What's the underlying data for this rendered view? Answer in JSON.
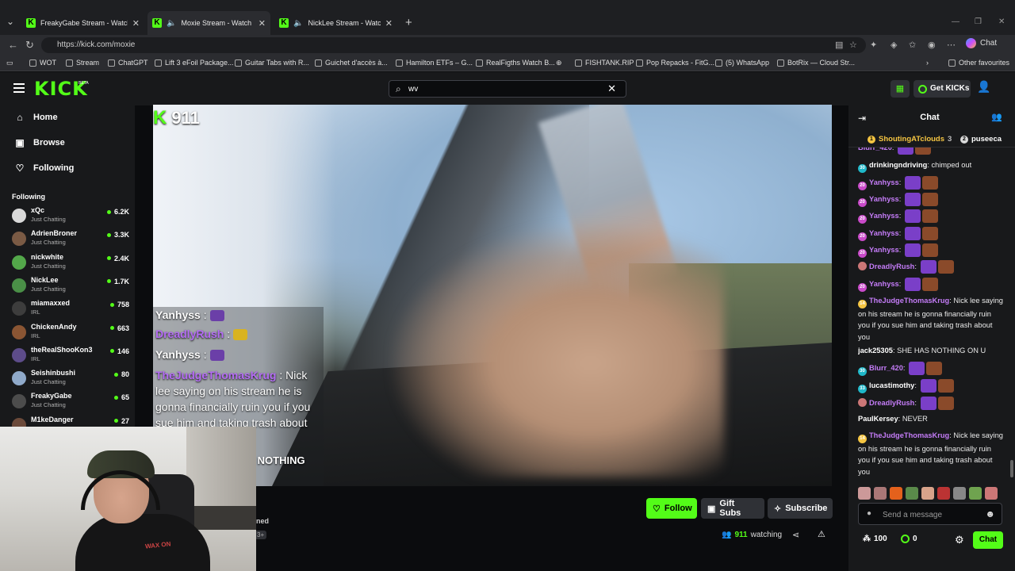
{
  "browser": {
    "tabs": [
      {
        "title": "FreakyGabe Stream - Watch Live on Kick",
        "active": false,
        "audio": false
      },
      {
        "title": "Moxie Stream - Watch Live on Kick",
        "active": true,
        "audio": true
      },
      {
        "title": "NickLee Stream - Watch Live on Kick",
        "active": false,
        "audio": true
      }
    ],
    "url": "https://kick.com/moxie",
    "copilot_label": "Chat",
    "bookmarks": [
      "WOT",
      "Stream",
      "ChatGPT",
      "Lift 3 eFoil Package...",
      "Guitar Tabs with R...",
      "Guichet d'accès à...",
      "Hamilton ETFs – G...",
      "RealFigths Watch B...",
      "",
      "FISHTANK.RIP",
      "Pop Repacks - FitG...",
      "(5) WhatsApp",
      "BotRix — Cloud Str..."
    ],
    "other_favourites": "Other favourites"
  },
  "kick": {
    "logo": "KICK",
    "beta": "BETA",
    "search_value": "wv",
    "get_kicks": "Get KICKs"
  },
  "sidebar": {
    "nav": [
      {
        "label": "Home",
        "icon": "home-icon"
      },
      {
        "label": "Browse",
        "icon": "browse-icon"
      },
      {
        "label": "Following",
        "icon": "heart-icon"
      }
    ],
    "following_title": "Following",
    "following": [
      {
        "name": "xQc",
        "category": "Just Chatting",
        "viewers": "6.2K",
        "color": "#d9d9d9"
      },
      {
        "name": "AdrienBroner",
        "category": "Just Chatting",
        "viewers": "3.3K",
        "color": "#7a5a44"
      },
      {
        "name": "nickwhite",
        "category": "Just Chatting",
        "viewers": "2.4K",
        "color": "#53a84a"
      },
      {
        "name": "NickLee",
        "category": "Just Chatting",
        "viewers": "1.7K",
        "color": "#4a8f47"
      },
      {
        "name": "miamaxxed",
        "category": "IRL",
        "viewers": "758",
        "color": "#3d3d3d"
      },
      {
        "name": "ChickenAndy",
        "category": "IRL",
        "viewers": "663",
        "color": "#8a5533"
      },
      {
        "name": "theRealShooKon3",
        "category": "IRL",
        "viewers": "146",
        "color": "#5d4c8a"
      },
      {
        "name": "Seishinbushi",
        "category": "Just Chatting",
        "viewers": "80",
        "color": "#8fa9c9"
      },
      {
        "name": "FreakyGabe",
        "category": "Just Chatting",
        "viewers": "65",
        "color": "#4c4c4c"
      },
      {
        "name": "M1keDanger",
        "category": "",
        "viewers": "27",
        "color": "#6b4a3a"
      }
    ]
  },
  "video": {
    "viewer_count": "911",
    "overlay_chat": [
      {
        "user": "Yanhyss",
        "text": ""
      },
      {
        "user": "DreadlyRush",
        "text": ""
      },
      {
        "user": "Yanhyss",
        "text": ""
      },
      {
        "user": "TheJudgeThomasKrug",
        "text": "Nick lee saying on his stream he is gonna financially ruin you if you sue him and taking trash about"
      },
      {
        "user": "",
        "text": "AS NOTHING"
      }
    ]
  },
  "stream": {
    "follow": "Follow",
    "gift_subs": "Gift Subs",
    "subscribe": "Subscribe",
    "watching_count": "911",
    "watching_label": "watching",
    "tag_a": "ned",
    "tag_b": "3+"
  },
  "webcam": {
    "shirt_text": "WAX ON"
  },
  "chat": {
    "title": "Chat",
    "pinned": [
      {
        "name": "ShoutingATclouds",
        "count": "3",
        "color": "#f5c542"
      },
      {
        "name": "puseeca",
        "count": "",
        "color": "#d9d9d9"
      }
    ],
    "messages": [
      {
        "user": "Blurr_420",
        "text": "",
        "color": "#c47cf7",
        "badge": "",
        "emote": true
      },
      {
        "user": "drinkingndriving",
        "text": "chimped out",
        "color": "#ffffff",
        "badge": "30",
        "emote": false
      },
      {
        "user": "Yanhyss",
        "text": "",
        "color": "#c47cf7",
        "badge": "20",
        "emote": true
      },
      {
        "user": "Yanhyss",
        "text": "",
        "color": "#c47cf7",
        "badge": "20",
        "emote": true
      },
      {
        "user": "Yanhyss",
        "text": "",
        "color": "#c47cf7",
        "badge": "20",
        "emote": true
      },
      {
        "user": "Yanhyss",
        "text": "",
        "color": "#c47cf7",
        "badge": "20",
        "emote": true
      },
      {
        "user": "Yanhyss",
        "text": "",
        "color": "#c47cf7",
        "badge": "20",
        "emote": true
      },
      {
        "user": "DreadlyRush",
        "text": "",
        "color": "#c47cf7",
        "badge": "",
        "emote": true
      },
      {
        "user": "Yanhyss",
        "text": "",
        "color": "#c47cf7",
        "badge": "20",
        "emote": true
      },
      {
        "user": "TheJudgeThomasKrug",
        "text": "Nick lee saying on his stream he is gonna financially ruin you if you sue him and taking trash about you",
        "color": "#c47cf7",
        "badge": "14",
        "emote": false
      },
      {
        "user": "jack25305",
        "text": "SHE HAS NOTHING ON U",
        "color": "#ffffff",
        "badge": "",
        "emote": false
      },
      {
        "user": "Blurr_420",
        "text": "",
        "color": "#c47cf7",
        "badge": "30",
        "emote": true
      },
      {
        "user": "lucastimothy",
        "text": "",
        "color": "#ffffff",
        "badge": "33",
        "emote": true
      },
      {
        "user": "DreadlyRush",
        "text": "",
        "color": "#c47cf7",
        "badge": "",
        "emote": true
      },
      {
        "user": "PaulKersey",
        "text": "NEVER",
        "color": "#ffffff",
        "badge": "",
        "emote": false
      },
      {
        "user": "TheJudgeThomasKrug",
        "text": "Nick lee saying on his stream he is gonna financially ruin you if you sue him and taking trash about you",
        "color": "#c47cf7",
        "badge": "14",
        "emote": false
      }
    ],
    "input_placeholder": "Send a message",
    "points": "100",
    "kicks": "0",
    "send": "Chat"
  }
}
